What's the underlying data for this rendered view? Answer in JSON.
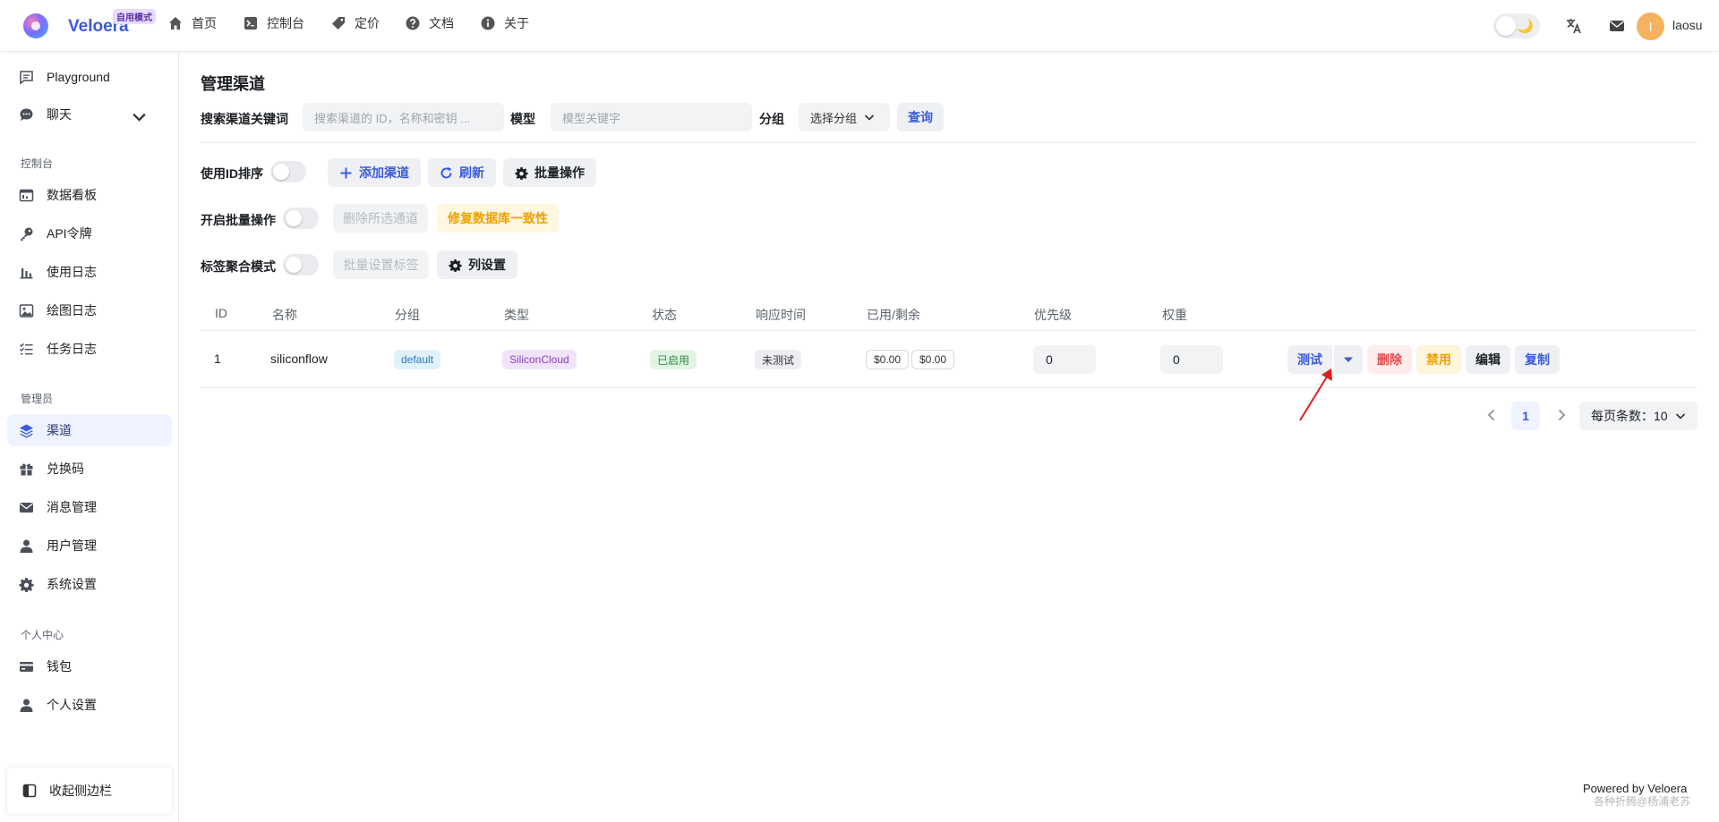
{
  "topbar": {
    "brand": "Veloera",
    "mode_badge": "自用模式",
    "nav": [
      "首页",
      "控制台",
      "定价",
      "文档",
      "关于"
    ],
    "username": "laosu",
    "avatar_initial": "l"
  },
  "sidebar": {
    "items_top": [
      "Playground",
      "聊天"
    ],
    "section_console": "控制台",
    "items_console": [
      "数据看板",
      "API令牌",
      "使用日志",
      "绘图日志",
      "任务日志"
    ],
    "section_admin": "管理员",
    "items_admin": [
      "渠道",
      "兑换码",
      "消息管理",
      "用户管理",
      "系统设置"
    ],
    "section_personal": "个人中心",
    "items_personal": [
      "钱包",
      "个人设置"
    ],
    "collapse": "收起侧边栏"
  },
  "page": {
    "title": "管理渠道",
    "search": {
      "keyword_label": "搜索渠道关键词",
      "keyword_placeholder": "搜索渠道的 ID，名称和密钥 ...",
      "model_label": "模型",
      "model_placeholder": "模型关键字",
      "group_label": "分组",
      "group_value": "选择分组",
      "query_button": "查询"
    },
    "toolbar1": {
      "label": "使用ID排序",
      "add": "添加渠道",
      "refresh": "刷新",
      "batch": "批量操作"
    },
    "toolbar2": {
      "label": "开启批量操作",
      "delete_selected": "删除所选通道",
      "fix_db": "修复数据库一致性"
    },
    "toolbar3": {
      "label": "标签聚合模式",
      "batch_tag": "批量设置标签",
      "columns": "列设置"
    }
  },
  "table": {
    "columns": [
      "ID",
      "名称",
      "分组",
      "类型",
      "状态",
      "响应时间",
      "已用/剩余",
      "优先级",
      "权重"
    ],
    "rows": [
      {
        "id": "1",
        "name": "siliconflow",
        "group": "default",
        "type": "SiliconCloud",
        "status": "已启用",
        "response": "未测试",
        "used": "$0.00",
        "remaining": "$0.00",
        "priority": "0",
        "weight": "0",
        "actions": {
          "test": "测试",
          "delete": "删除",
          "disable": "禁用",
          "edit": "编辑",
          "copy": "复制"
        }
      }
    ]
  },
  "pagination": {
    "current": "1",
    "page_size": "每页条数：10"
  },
  "footer": {
    "powered": "Powered by Veloera",
    "watermark": "各种折腾@杨浦老苏"
  },
  "colors": {
    "accent": "#3b5bdb",
    "danger": "#e5484d",
    "warning": "#f0a000",
    "active_bg": "#eef3ff"
  }
}
